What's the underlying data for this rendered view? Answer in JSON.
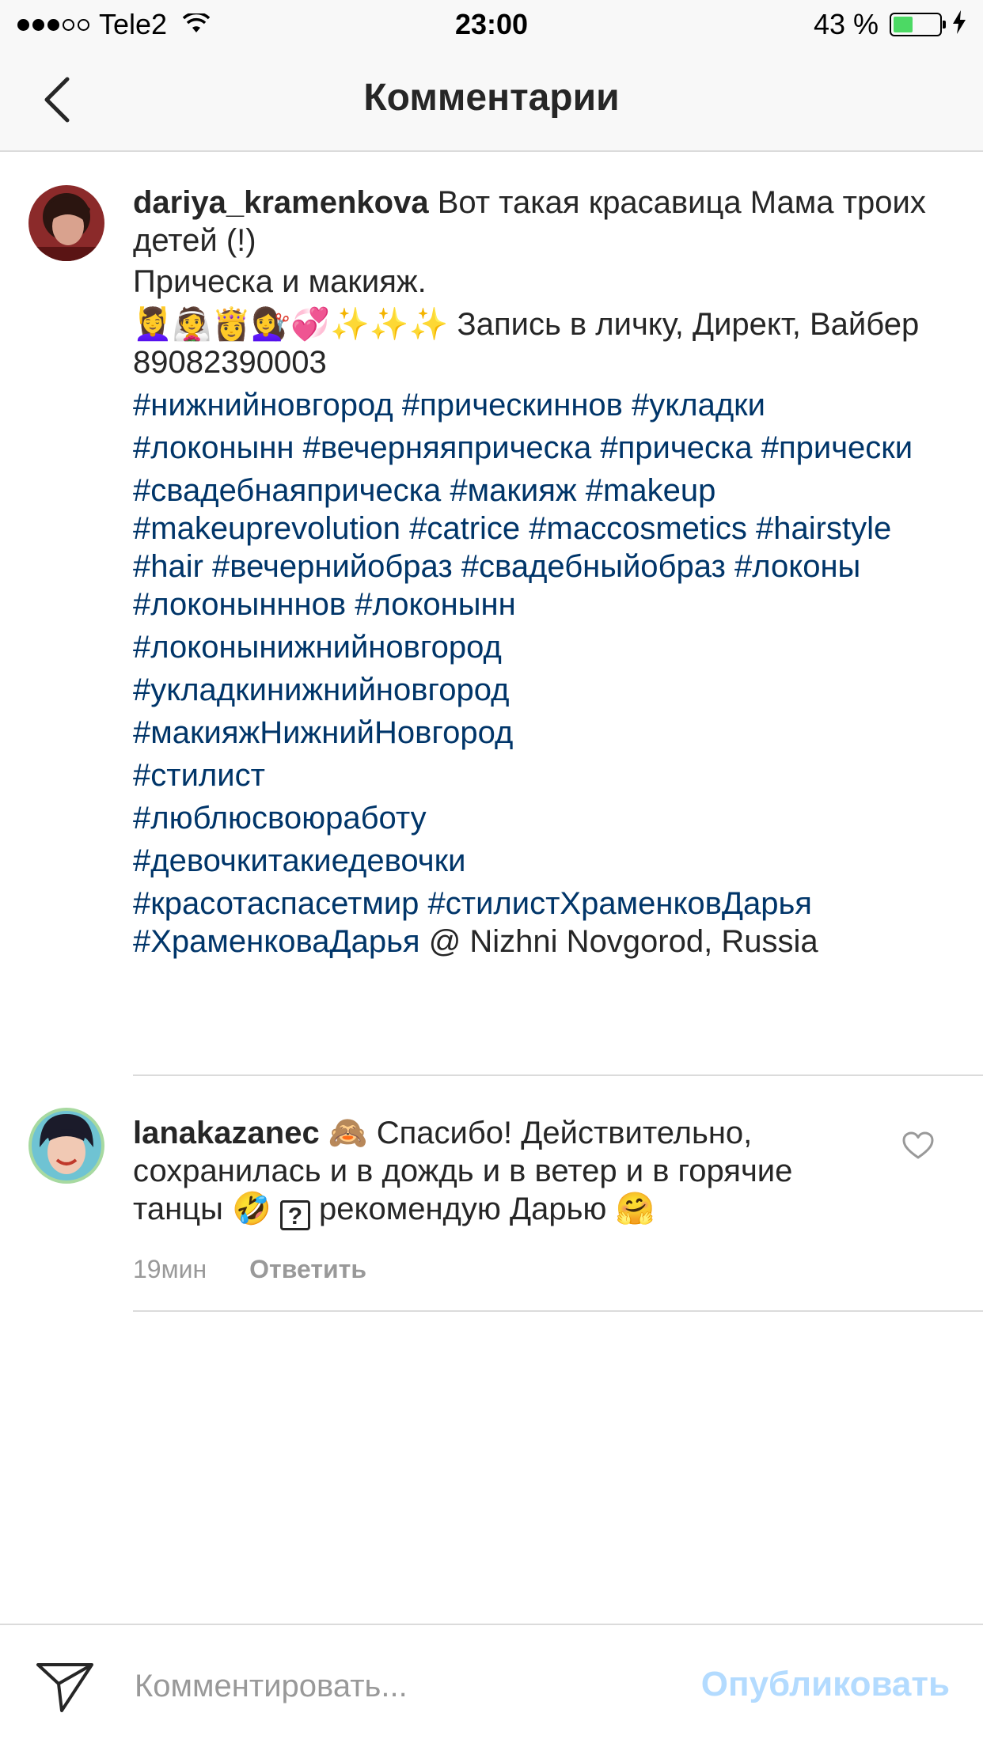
{
  "status_bar": {
    "carrier": "Tele2",
    "time": "23:00",
    "battery_percent": "43 %",
    "battery_level": 0.43,
    "signal_bars_filled": 3,
    "signal_bars_total": 5
  },
  "header": {
    "title": "Комментарии",
    "back_icon": "chevron-left-icon"
  },
  "comments": [
    {
      "username": "dariya_kramenkova",
      "text_line_1": " Вот такая красавица Мама троих детей (!)",
      "text_line_2": "Прическа и макияж.",
      "emojis": "💆‍♀️👰👸💇‍♀️💞✨✨✨",
      "text_line_3": " Запись в личку, Директ, Вайбер 89082390003",
      "hashtags_1": "#нижнийновгород #прическиннов #укладки",
      "hashtags_2": "#локонынн #вечерняяприческа #прическа #прически",
      "hashtags_3": "#свадебнаяприческа #макияж  #makeup #makeuprevolution #catrice  #maccosmetics #hairstyle #hair  #вечернийобраз #свадебныйобраз #локоны #локонынннов #локонынн",
      "hashtags_4": "#локонынижнийновгород",
      "hashtags_5": "#укладкинижнийновгород",
      "hashtags_6": "#макияжНижнийНовгород",
      "hashtags_7": "#стилист",
      "hashtags_8": "#люблюсвоюработу",
      "hashtags_9": "#девочкитакиедевочки",
      "hashtags_10": "#красотаспасетмир  #стилистХраменковДарья #ХраменковаДарья",
      "location": " @ Nizhni Novgorod, Russia"
    },
    {
      "username": "lanakazanec",
      "emoji_1": "🙈",
      "text_1": " Спасибо! Действительно, сохранилась и в дождь и в ветер и в горячие танцы ",
      "emoji_2": "🤣",
      "unknown_glyph": "?",
      "text_2": " рекомендую Дарью ",
      "emoji_3": "🤗",
      "time": "19мин",
      "reply_label": "Ответить",
      "like_icon": "heart-outline-icon"
    }
  ],
  "composer": {
    "placeholder": "Комментировать...",
    "publish_label": "Опубликовать",
    "send_icon": "send-paper-plane-icon"
  },
  "colors": {
    "hashtag": "#003569",
    "text": "#262626",
    "muted": "#999999",
    "publish_disabled": "#b3dbff",
    "divider": "#dbdbdb"
  }
}
